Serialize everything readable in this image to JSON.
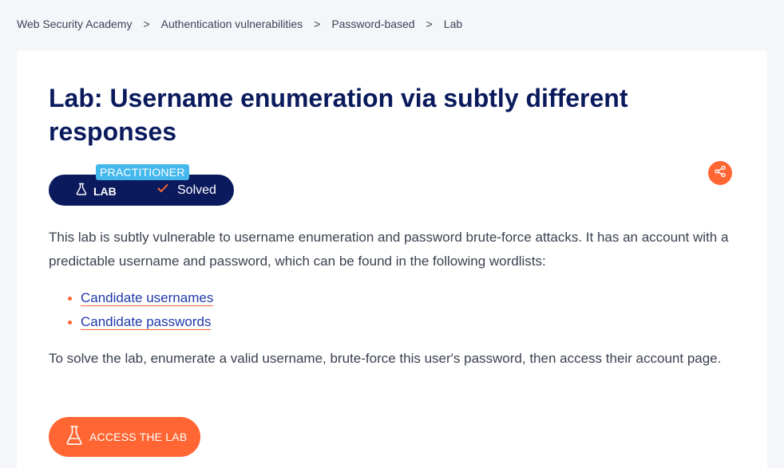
{
  "breadcrumb": {
    "items": [
      "Web Security Academy",
      "Authentication vulnerabilities",
      "Password-based",
      "Lab"
    ],
    "separator": ">"
  },
  "lab": {
    "title": "Lab: Username enumeration via subtly different responses",
    "level": "PRACTITIONER",
    "type_label": "LAB",
    "status": "Solved",
    "description": "This lab is subtly vulnerable to username enumeration and password brute-force attacks. It has an account with a predictable username and password, which can be found in the following wordlists:",
    "wordlists": [
      "Candidate usernames",
      "Candidate passwords"
    ],
    "instructions": "To solve the lab, enumerate a valid username, brute-force this user's password, then access their account page.",
    "access_button": "ACCESS THE LAB"
  },
  "icons": {
    "share": "share-icon",
    "flask": "flask-icon",
    "check": "check-icon"
  },
  "colors": {
    "navy": "#0a1a5c",
    "accent": "#ff6633",
    "badge": "#44b8ec",
    "link": "#1f3aa8",
    "background": "#f4f6fa"
  }
}
